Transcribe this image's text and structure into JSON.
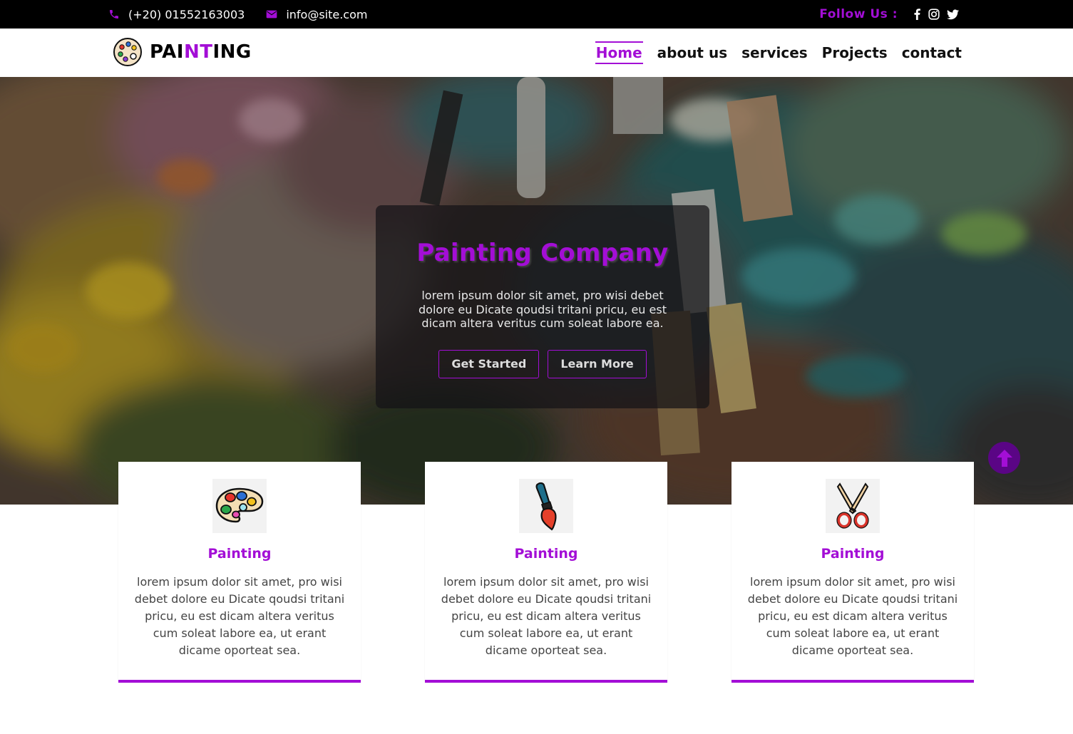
{
  "topbar": {
    "phone": "(+20) 01552163003",
    "email": "info@site.com",
    "follow_label": "Follow Us :",
    "social_icons": [
      "facebook-icon",
      "instagram-icon",
      "twitter-icon"
    ]
  },
  "brand": {
    "name_part1": "PAI",
    "name_part2": "NT",
    "name_part3": "ING"
  },
  "nav": {
    "items": [
      {
        "label": "Home",
        "active": true
      },
      {
        "label": "about us",
        "active": false
      },
      {
        "label": "services",
        "active": false
      },
      {
        "label": "Projects",
        "active": false
      },
      {
        "label": "contact",
        "active": false
      }
    ]
  },
  "hero": {
    "title": "Painting Company",
    "text": "lorem ipsum dolor sit amet, pro wisi debet dolore eu Dicate qoudsi tritani pricu, eu est dicam altera veritus cum soleat labore ea.",
    "primary_button": "Get Started",
    "secondary_button": "Learn More"
  },
  "services": [
    {
      "icon": "palette-icon",
      "title": "Painting",
      "text": "lorem ipsum dolor sit amet, pro wisi debet dolore eu Dicate qoudsi tritani pricu, eu est dicam altera veritus cum soleat labore ea, ut erant dicame oporteat sea."
    },
    {
      "icon": "paintbrush-icon",
      "title": "Painting",
      "text": "lorem ipsum dolor sit amet, pro wisi debet dolore eu Dicate qoudsi tritani pricu, eu est dicam altera veritus cum soleat labore ea, ut erant dicame oporteat sea."
    },
    {
      "icon": "scissors-icon",
      "title": "Painting",
      "text": "lorem ipsum dolor sit amet, pro wisi debet dolore eu Dicate qoudsi tritani pricu, eu est dicam altera veritus cum soleat labore ea, ut erant dicame oporteat sea."
    }
  ],
  "colors": {
    "accent": "#a30ed6",
    "topbar_bg": "#000000",
    "scroll_top_bg": "#5a0585"
  }
}
